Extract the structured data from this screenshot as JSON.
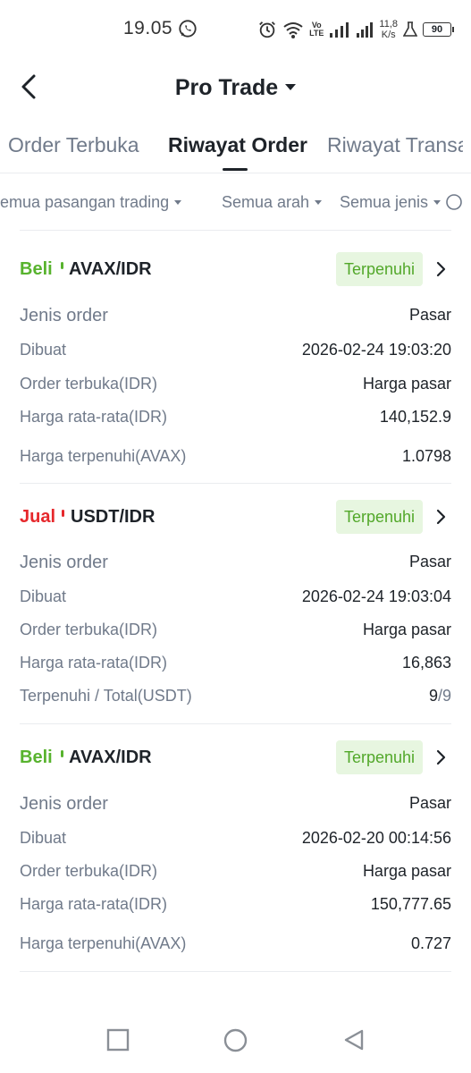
{
  "status_bar": {
    "time": "19.05",
    "lte_top": "Vo",
    "lte_bottom": "LTE",
    "net_speed_value": "11,8",
    "net_speed_unit": "K/s",
    "battery": "90"
  },
  "header": {
    "title": "Pro Trade"
  },
  "tabs": {
    "open_orders": "Order Terbuka",
    "order_history": "Riwayat Order",
    "trade_history": "Riwayat Transaksi",
    "active": "order_history"
  },
  "filters": {
    "pairs": "Semua pasangan trading",
    "direction": "Semua arah",
    "type": "Semua jenis"
  },
  "orders": [
    {
      "side": "Beli",
      "pair": "AVAX/IDR",
      "status": "Terpenuhi",
      "rows": [
        {
          "label": "Jenis order",
          "value": "Pasar"
        },
        {
          "label": "Dibuat",
          "value": "2026-02-24 19:03:20"
        },
        {
          "label": "Order terbuka(IDR)",
          "value": "Harga pasar"
        },
        {
          "label": "Harga rata-rata(IDR)",
          "value": "140,152.9"
        },
        {
          "label": "Harga terpenuhi(AVAX)",
          "value": "1.0798"
        }
      ]
    },
    {
      "side": "Jual",
      "pair": "USDT/IDR",
      "status": "Terpenuhi",
      "rows": [
        {
          "label": "Jenis order",
          "value": "Pasar"
        },
        {
          "label": "Dibuat",
          "value": "2026-02-24 19:03:04"
        },
        {
          "label": "Order terbuka(IDR)",
          "value": "Harga pasar"
        },
        {
          "label": "Harga rata-rata(IDR)",
          "value": "16,863"
        },
        {
          "label": "Terpenuhi / Total(USDT)",
          "value_filled": "9",
          "value_sep": "/",
          "value_total": "9"
        }
      ]
    },
    {
      "side": "Beli",
      "pair": "AVAX/IDR",
      "status": "Terpenuhi",
      "rows": [
        {
          "label": "Jenis order",
          "value": "Pasar"
        },
        {
          "label": "Dibuat",
          "value": "2026-02-20 00:14:56"
        },
        {
          "label": "Order terbuka(IDR)",
          "value": "Harga pasar"
        },
        {
          "label": "Harga rata-rata(IDR)",
          "value": "150,777.65"
        },
        {
          "label": "Harga terpenuhi(AVAX)",
          "value": "0.727"
        }
      ]
    }
  ],
  "colors": {
    "buy": "#58b32e",
    "sell": "#e6282c",
    "badge_bg": "#e7f6e0",
    "badge_text": "#52a82a",
    "label": "#707a8a",
    "text": "#1e2329"
  }
}
